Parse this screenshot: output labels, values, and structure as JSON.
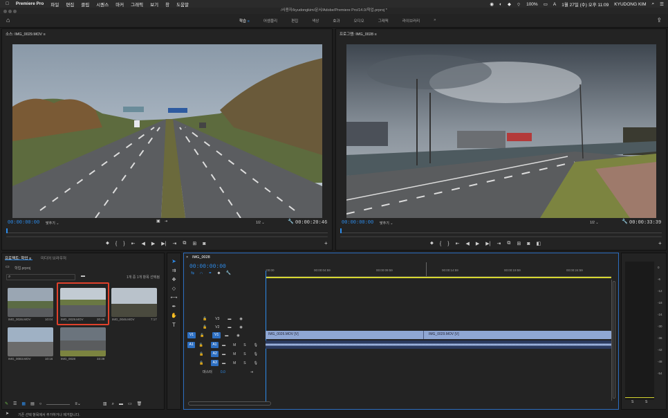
{
  "menubar": {
    "app": "Premiere Pro",
    "items": [
      "파일",
      "편집",
      "클립",
      "시퀀스",
      "마커",
      "그래픽",
      "보기",
      "창",
      "도움말"
    ],
    "battery": "100%",
    "datetime": "1월 27일 (수) 오후 11:09",
    "user": "KYUDONG KIM"
  },
  "window": {
    "title": "/사용자/kyudongkim/문서/Adobe/Premiere Pro/14.0/학업.prproj *"
  },
  "workspace": {
    "tabs": [
      "학습",
      "어셈블리",
      "편집",
      "색상",
      "효과",
      "오디오",
      "그래픽",
      "라이브러리"
    ],
    "active": "학습"
  },
  "source": {
    "title": "소스: IMG_0029.MOV",
    "timecode": "00:00:00:00",
    "fit": "맞추기",
    "resolution": "1/2",
    "duration": "00:00:20:46"
  },
  "program": {
    "title": "프로그램: IMG_0028",
    "timecode": "00:00:00:00",
    "fit": "맞추기",
    "resolution": "1/2",
    "duration": "00:00:33:39"
  },
  "project": {
    "tab_project": "프로젝트: 학업",
    "tab_media": "미디어 브라우저",
    "file": "학업.prproj",
    "selection": "1개 중 1개 항목 선택됨",
    "items": [
      {
        "name": "IMG_0026.MOV",
        "dur": "10:04"
      },
      {
        "name": "IMG_0029.MOV",
        "dur": "20:46"
      },
      {
        "name": "IMG_0046.MOV",
        "dur": "7:17"
      },
      {
        "name": "IMG_0083.MOV",
        "dur": "10:16"
      },
      {
        "name": "IMG_0028",
        "dur": "33:39"
      }
    ]
  },
  "timeline": {
    "title": "IMG_0028",
    "timecode": "00:00:00:00",
    "ruler": [
      ":00:00",
      "00:00:04:59",
      "00:00:09:59",
      "00:00:14:59",
      "00:00:19:59",
      "00:00:24:59"
    ],
    "video_tracks": [
      "V3",
      "V2",
      "V1"
    ],
    "audio_tracks": [
      "A1",
      "A2",
      "A3"
    ],
    "src_v": "V1",
    "src_a": "A1",
    "master": "마스터",
    "master_val": "0.0",
    "clip1": "IMG_0026.MOV [V]",
    "clip2": "IMG_0029.MOV [V]",
    "m": "M",
    "s": "S"
  },
  "meter": {
    "scale": [
      "0",
      "-6",
      "-12",
      "-18",
      "-24",
      "-30",
      "-36",
      "-42",
      "-48",
      "-54"
    ],
    "s": "S"
  },
  "status": {
    "text": "기존 선택 항목에서 추가하거나 제거합니다."
  }
}
